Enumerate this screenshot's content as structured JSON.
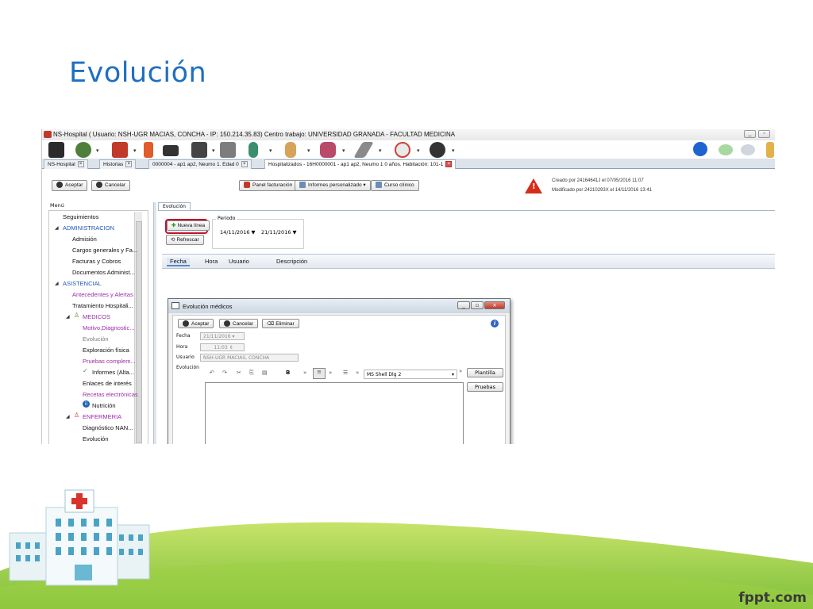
{
  "slide": {
    "title": "Evolución",
    "brand": "fppt.com"
  },
  "window": {
    "title": "NS-Hospital  ( Usuario: NSH-UGR MACIAS, CONCHA - IP: 150.214.35.83)     Centro trabajo: UNIVERSIDAD GRANADA - FACULTAD MEDICINA"
  },
  "tabs": [
    {
      "label": "NS-Hospital"
    },
    {
      "label": "Historias"
    },
    {
      "label": "0000004 - ap1 ap2, Neumo 1. Edad 0"
    },
    {
      "label": "Hospitalizados - 16H0000001 - ap1 ap2, Neumo 1 0 años. Habitación: 101-1"
    }
  ],
  "actions": {
    "aceptar": "Aceptar",
    "cancelar": "Cancelar",
    "panel_facturacion": "Panel facturación",
    "informes": "Informes personalizado",
    "curso_clinico": "Curso clínico"
  },
  "meta": {
    "creado": "Creado por 24164641J el 07/05/2016 11:07",
    "modificado": "Modificado por 24210293X el 14/11/2016 13:41"
  },
  "menu": {
    "label": "Menú",
    "items": [
      {
        "label": "Seguimientos"
      },
      {
        "label": "ADMINISTRACION"
      },
      {
        "label": "Admisión"
      },
      {
        "label": "Cargos generales y Fa..."
      },
      {
        "label": "Facturas y Cobros"
      },
      {
        "label": "Documentos Administ..."
      },
      {
        "label": "ASISTENCIAL"
      },
      {
        "label": "Antecedentes y Alertas"
      },
      {
        "label": "Tratamiento Hospitali..."
      },
      {
        "label": "MEDICOS"
      },
      {
        "label": "Motivo,Diagnostic..."
      },
      {
        "label": "Evolución"
      },
      {
        "label": "Exploración física"
      },
      {
        "label": "Pruebas complem..."
      },
      {
        "label": "Informes (Alta..."
      },
      {
        "label": "Enlaces de interés"
      },
      {
        "label": "Recetas electrónicas"
      },
      {
        "label": "Nutrición"
      },
      {
        "label": "ENFERMERIA"
      },
      {
        "label": "Diagnóstico NAN..."
      },
      {
        "label": "Evolución"
      }
    ]
  },
  "panel": {
    "tab": "Evolución",
    "nueva_linea": "Nueva línea",
    "refrescar": "Refrescar",
    "periodo_label": "Periodo",
    "fecha_desde": "14/11/2016",
    "fecha_hasta": "21/11/2016",
    "columns": [
      "Fecha",
      "Hora",
      "Usuario",
      "Descripción"
    ]
  },
  "dialog": {
    "title": "Evolución médicos",
    "aceptar": "Aceptar",
    "cancelar": "Cancelar",
    "eliminar": "Eliminar",
    "fecha_label": "Fecha",
    "fecha_value": "21/11/2016",
    "hora_label": "Hora",
    "hora_value": "11:03",
    "usuario_label": "Usuario",
    "usuario_value": "NSH-UGR MACIAS, CONCHA",
    "evolucion_label": "Evolución",
    "font": "MS Shell Dlg 2",
    "plantilla": "Plantilla",
    "pruebas": "Pruebas"
  },
  "colors": {
    "title": "#1f6fbf",
    "highlight": "#c0142b",
    "menu_blue": "#1f57b3",
    "menu_purple": "#9b2ca8",
    "grass": "#8cc63f"
  }
}
